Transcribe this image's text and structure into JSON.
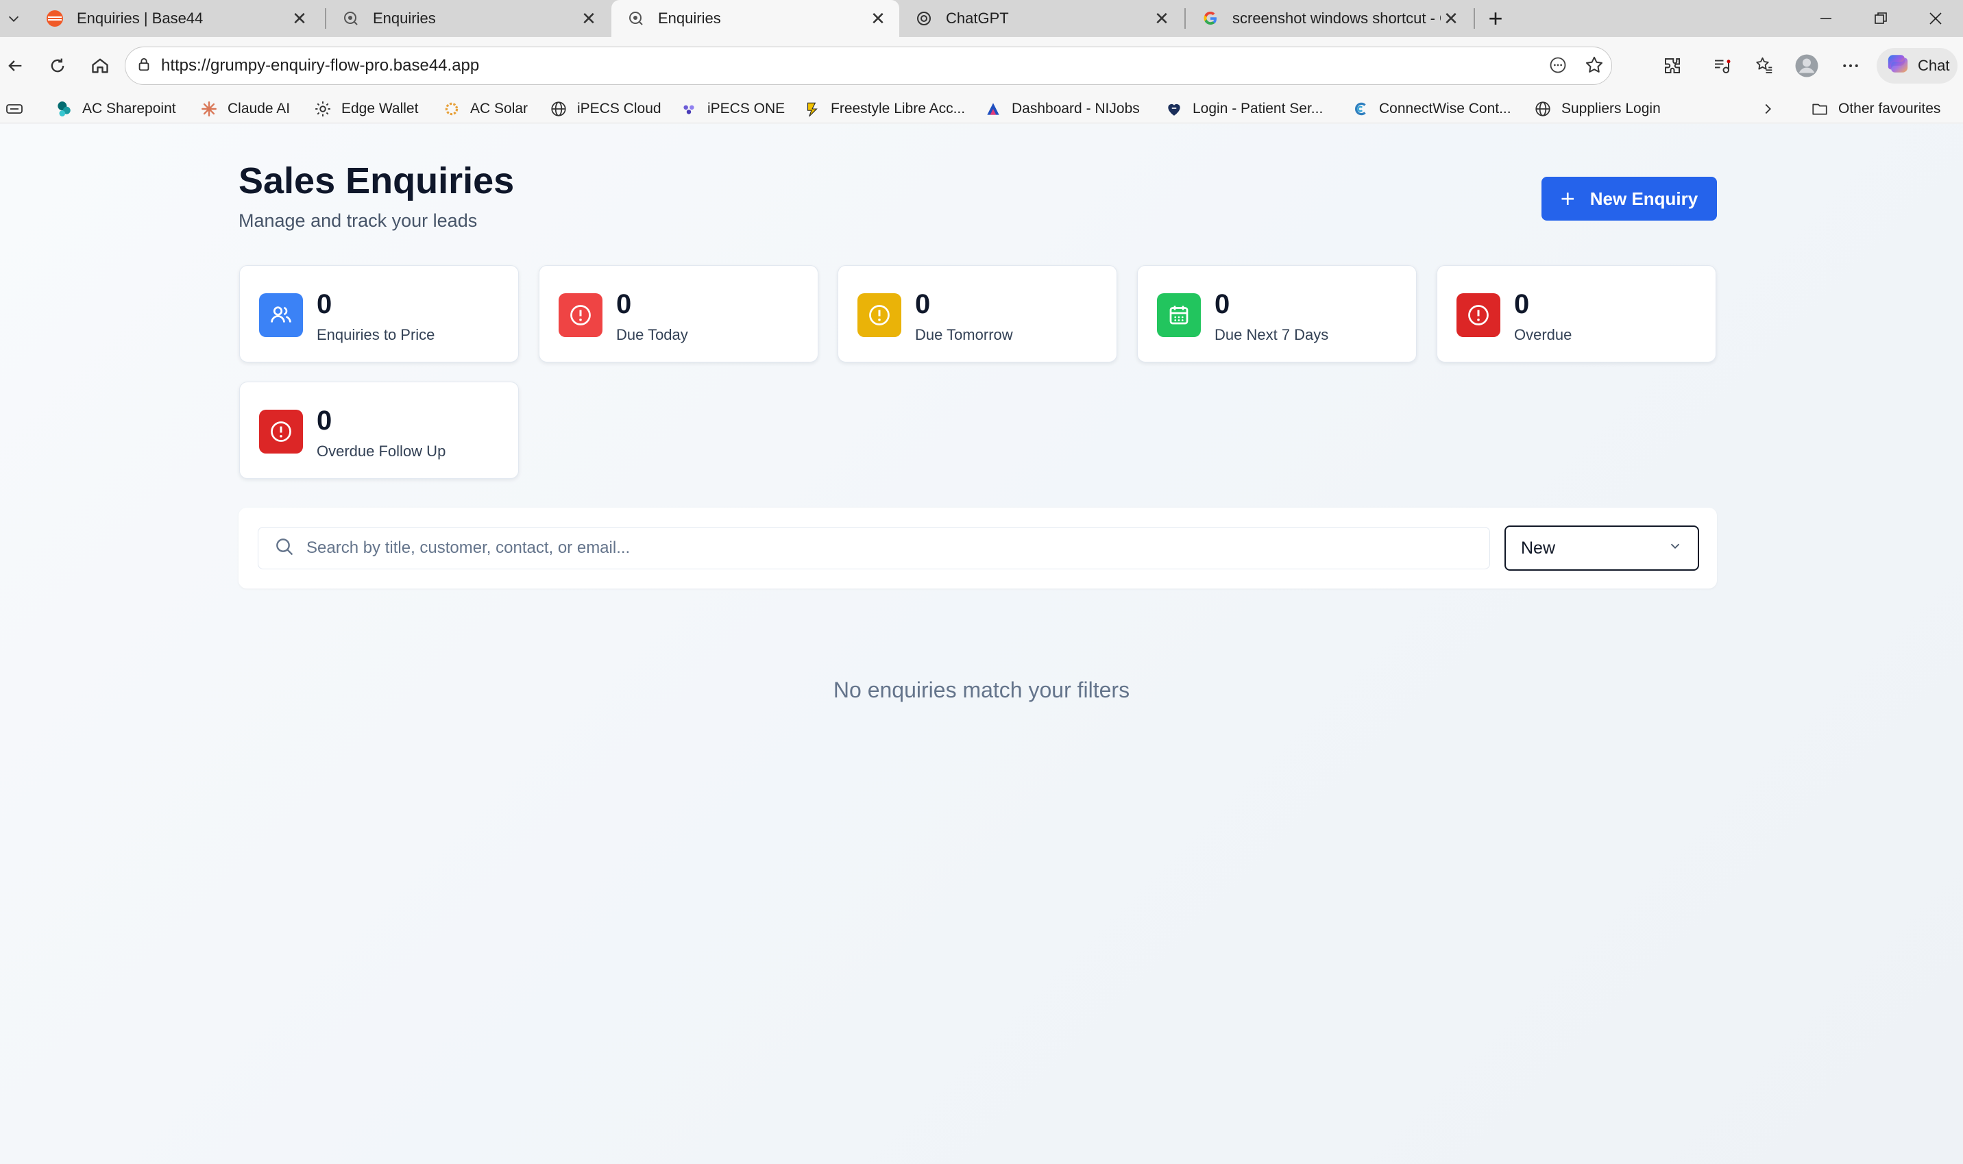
{
  "browser": {
    "tabs": [
      {
        "title": "Enquiries | Base44",
        "icon": "base44-favicon",
        "active": false
      },
      {
        "title": "Enquiries",
        "icon": "enquiries-favicon",
        "active": false
      },
      {
        "title": "Enquiries",
        "icon": "enquiries-favicon",
        "active": true
      },
      {
        "title": "ChatGPT",
        "icon": "chatgpt-favicon",
        "active": false
      },
      {
        "title": "screenshot windows shortcut - Go",
        "icon": "google-favicon",
        "active": false
      }
    ],
    "url": "https://grumpy-enquiry-flow-pro.base44.app",
    "chat_label": "Chat",
    "favourites": [
      {
        "label": "AC Sharepoint",
        "icon": "sharepoint-icon"
      },
      {
        "label": "Claude AI",
        "icon": "claude-icon"
      },
      {
        "label": "Edge Wallet",
        "icon": "wallet-gear-icon"
      },
      {
        "label": "AC Solar",
        "icon": "solar-icon"
      },
      {
        "label": "iPECS Cloud",
        "icon": "globe-icon"
      },
      {
        "label": "iPECS ONE",
        "icon": "ipecs-icon"
      },
      {
        "label": "Freestyle Libre Acc...",
        "icon": "libre-icon"
      },
      {
        "label": "Dashboard - NIJobs",
        "icon": "nijobs-icon"
      },
      {
        "label": "Login - Patient Ser...",
        "icon": "heart-icon"
      },
      {
        "label": "ConnectWise Cont...",
        "icon": "connectwise-icon"
      },
      {
        "label": "Suppliers Login",
        "icon": "globe-icon"
      }
    ],
    "other_favourites": "Other favourites"
  },
  "header": {
    "title": "Sales Enquiries",
    "subtitle": "Manage and track your leads",
    "new_button_label": "New Enquiry"
  },
  "stats": [
    {
      "value": "0",
      "label": "Enquiries to Price",
      "icon": "users-icon",
      "color": "#3b82f6"
    },
    {
      "value": "0",
      "label": "Due Today",
      "icon": "alert-circle-icon",
      "color": "#ef4444"
    },
    {
      "value": "0",
      "label": "Due Tomorrow",
      "icon": "alert-circle-icon",
      "color": "#eab308"
    },
    {
      "value": "0",
      "label": "Due Next 7 Days",
      "icon": "calendar-icon",
      "color": "#22c55e"
    },
    {
      "value": "0",
      "label": "Overdue",
      "icon": "alert-circle-icon",
      "color": "#dc2626"
    },
    {
      "value": "0",
      "label": "Overdue Follow Up",
      "icon": "alert-circle-icon",
      "color": "#dc2626"
    }
  ],
  "filters": {
    "search_placeholder": "Search by title, customer, contact, or email...",
    "search_value": "",
    "status_selected": "New"
  },
  "empty_message": "No enquiries match your filters"
}
